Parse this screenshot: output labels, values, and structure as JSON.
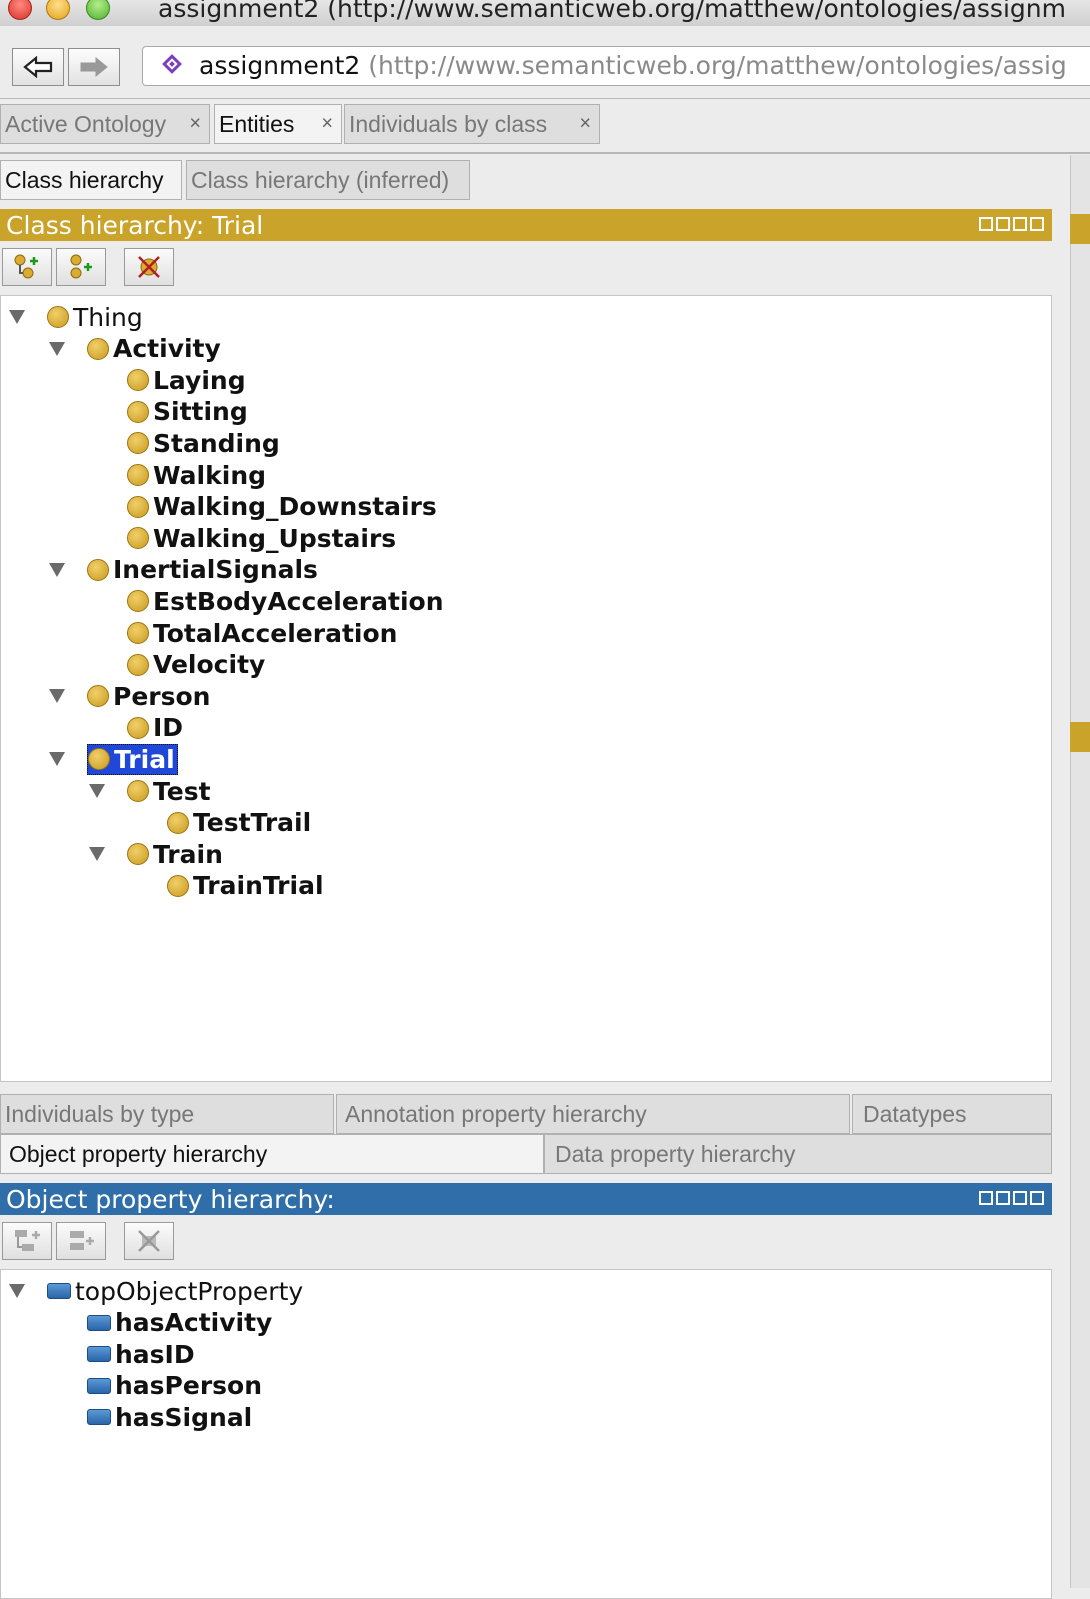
{
  "window": {
    "title": "assignment2 (http://www.semanticweb.org/matthew/ontologies/assignm"
  },
  "address": {
    "name": "assignment2",
    "url": "(http://www.semanticweb.org/matthew/ontologies/assig"
  },
  "main_tabs": [
    {
      "label": "Active Ontology",
      "close": "×"
    },
    {
      "label": "Entities",
      "close": "×"
    },
    {
      "label": "Individuals by class",
      "close": "×"
    }
  ],
  "class_tabs": [
    {
      "label": "Class hierarchy"
    },
    {
      "label": "Class hierarchy (inferred)"
    }
  ],
  "class_panel": {
    "title": "Class hierarchy: Trial",
    "header_color": "#c9a32a",
    "tree": [
      {
        "label": "Thing",
        "level": 0,
        "expanded": true,
        "bold": false
      },
      {
        "label": "Activity",
        "level": 1,
        "expanded": true,
        "bold": true
      },
      {
        "label": "Laying",
        "level": 2,
        "bold": true
      },
      {
        "label": "Sitting",
        "level": 2,
        "bold": true
      },
      {
        "label": "Standing",
        "level": 2,
        "bold": true
      },
      {
        "label": "Walking",
        "level": 2,
        "bold": true
      },
      {
        "label": "Walking_Downstairs",
        "level": 2,
        "bold": true
      },
      {
        "label": "Walking_Upstairs",
        "level": 2,
        "bold": true
      },
      {
        "label": "InertialSignals",
        "level": 1,
        "expanded": true,
        "bold": true
      },
      {
        "label": "EstBodyAcceleration",
        "level": 2,
        "bold": true
      },
      {
        "label": "TotalAcceleration",
        "level": 2,
        "bold": true
      },
      {
        "label": "Velocity",
        "level": 2,
        "bold": true
      },
      {
        "label": "Person",
        "level": 1,
        "expanded": true,
        "bold": true
      },
      {
        "label": "ID",
        "level": 2,
        "bold": true
      },
      {
        "label": "Trial",
        "level": 1,
        "expanded": true,
        "bold": true,
        "selected": true
      },
      {
        "label": "Test",
        "level": 2,
        "expanded": true,
        "bold": true
      },
      {
        "label": "TestTrail",
        "level": 3,
        "bold": true
      },
      {
        "label": "Train",
        "level": 2,
        "expanded": true,
        "bold": true
      },
      {
        "label": "TrainTrial",
        "level": 3,
        "bold": true
      }
    ]
  },
  "bottom_tabs_row1": [
    {
      "label": "Individuals by type"
    },
    {
      "label": "Annotation property hierarchy"
    },
    {
      "label": "Datatypes"
    }
  ],
  "bottom_tabs_row2": [
    {
      "label": "Object property hierarchy"
    },
    {
      "label": "Data property hierarchy"
    }
  ],
  "object_panel": {
    "title": "Object property hierarchy:",
    "header_color": "#2f6ea8",
    "tree": [
      {
        "label": "topObjectProperty",
        "level": 0,
        "expanded": true,
        "bold": false
      },
      {
        "label": "hasActivity",
        "level": 1,
        "bold": true
      },
      {
        "label": "hasID",
        "level": 1,
        "bold": true
      },
      {
        "label": "hasPerson",
        "level": 1,
        "bold": true
      },
      {
        "label": "hasSignal",
        "level": 1,
        "bold": true
      }
    ]
  }
}
